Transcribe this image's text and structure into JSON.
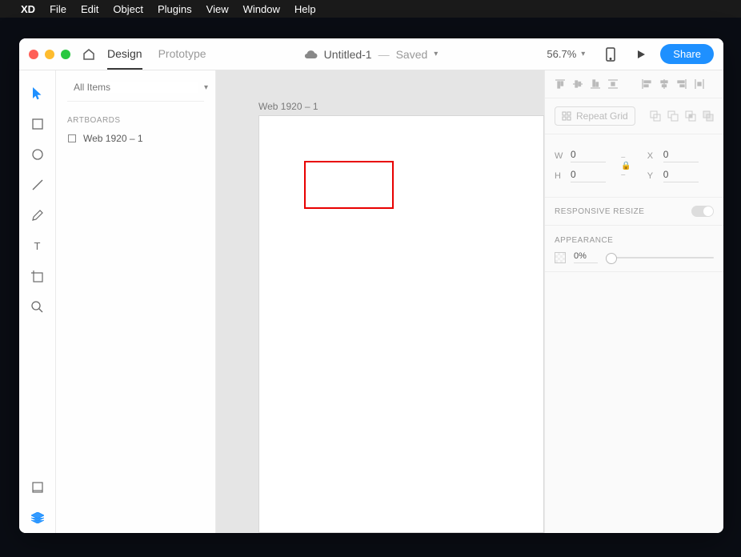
{
  "menubar": {
    "app": "XD",
    "items": [
      "File",
      "Edit",
      "Object",
      "Plugins",
      "View",
      "Window",
      "Help"
    ]
  },
  "tabs": {
    "design": "Design",
    "prototype": "Prototype"
  },
  "document": {
    "title": "Untitled-1",
    "status": "Saved"
  },
  "zoom": "56.7%",
  "share": "Share",
  "left": {
    "search_placeholder": "All Items",
    "section": "Artboards",
    "artboard": "Web 1920 – 1"
  },
  "canvas": {
    "artboard_label": "Web 1920 – 1"
  },
  "right": {
    "repeat_grid": "Repeat Grid",
    "w_label": "W",
    "w": "0",
    "h_label": "H",
    "h": "0",
    "x_label": "X",
    "x": "0",
    "y_label": "Y",
    "y": "0",
    "responsive": "Responsive Resize",
    "appearance": "Appearance",
    "opacity": "0%"
  }
}
